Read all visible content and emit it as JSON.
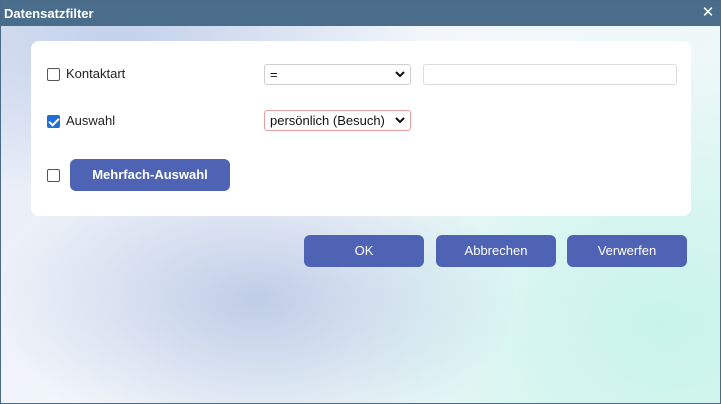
{
  "dialog": {
    "title": "Datensatzfilter",
    "close_icon": "close-icon",
    "close_glyph": "✕"
  },
  "rows": {
    "kontaktart": {
      "checked": false,
      "label": "Kontaktart",
      "operator_value": "=",
      "text_value": ""
    },
    "auswahl": {
      "checked": true,
      "label": "Auswahl",
      "select_value": "persönlich (Besuch)"
    },
    "mehrfach": {
      "checked": false,
      "button_label": "Mehrfach-Auswahl"
    }
  },
  "buttons": {
    "ok_label": "OK",
    "cancel_label": "Abbrechen",
    "discard_label": "Verwerfen"
  },
  "colors": {
    "titlebar": "#4a6d8c",
    "button": "#4f63b5",
    "checkbox_checked": "#1f6fd6"
  }
}
